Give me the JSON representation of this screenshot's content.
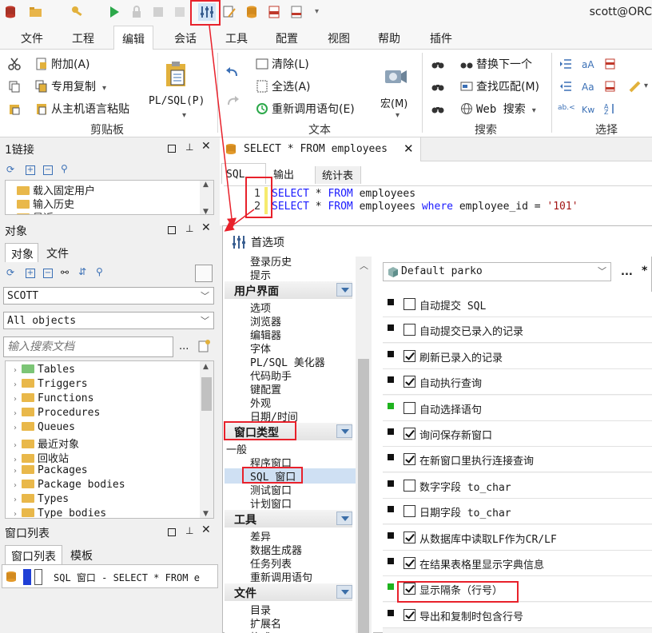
{
  "app": {
    "connection_title": "scott@ORC"
  },
  "ribbon_tabs": [
    "文件",
    "工程",
    "编辑",
    "会话",
    "工具",
    "配置",
    "视图",
    "帮助",
    "插件"
  ],
  "ribbon": {
    "clipboard": {
      "append": "附加(A)",
      "special_copy": "专用复制",
      "paste_from_host": "从主机语言粘贴",
      "plsql_label": "PL/SQL(P)",
      "group": "剪贴板"
    },
    "text": {
      "clear": "清除(L)",
      "select_all": "全选(A)",
      "recall": "重新调用语句(E)",
      "macro": "宏(M)",
      "group": "文本"
    },
    "search": {
      "replace_next": "替换下一个",
      "find_match": "查找匹配(M)",
      "web_search": "Web 搜索",
      "group": "搜索"
    },
    "selection": {
      "group": "选择"
    }
  },
  "connections_panel": {
    "title": "1链接",
    "items": [
      "载入固定用户",
      "输入历史",
      "最近"
    ]
  },
  "objects_panel": {
    "title": "对象",
    "tabs": [
      "对象",
      "文件"
    ],
    "schema": "SCOTT",
    "filter": "All objects",
    "search_placeholder": "输入搜索文档",
    "tree": [
      "Tables",
      "Triggers",
      "Functions",
      "Procedures",
      "Queues",
      "最近对象",
      "回收站",
      "Packages",
      "Package bodies",
      "Types",
      "Type bodies"
    ]
  },
  "window_list_panel": {
    "title": "窗口列表",
    "tabs": [
      "窗口列表",
      "模板"
    ],
    "item": "SQL 窗口 - SELECT * FROM e"
  },
  "editor": {
    "tab_title": "SELECT * FROM employees",
    "subtabs": [
      "SQL",
      "输出",
      "统计表"
    ],
    "lines": [
      {
        "num": "1",
        "parts": [
          [
            "kw",
            "SELECT"
          ],
          [
            "t",
            " * "
          ],
          [
            "kw",
            "FROM"
          ],
          [
            "t",
            " employees"
          ]
        ]
      },
      {
        "num": "2",
        "parts": [
          [
            "kw",
            "SELECT"
          ],
          [
            "t",
            " * "
          ],
          [
            "kw",
            "FROM"
          ],
          [
            "t",
            " employees "
          ],
          [
            "kw",
            "where"
          ],
          [
            "t",
            " employee_id = "
          ],
          [
            "str",
            "'101'"
          ]
        ]
      }
    ]
  },
  "preferences": {
    "title": "首选项",
    "profile": "Default parko",
    "nav": {
      "top_items": [
        "登录历史",
        "提示"
      ],
      "sections": [
        {
          "label": "用户界面",
          "items": [
            "选项",
            "浏览器",
            "编辑器",
            "字体",
            "PL/SQL 美化器",
            "代码助手",
            "键配置",
            "外观",
            "日期/时间"
          ]
        },
        {
          "label": "窗口类型",
          "items": [
            "一般",
            "程序窗口",
            "SQL 窗口",
            "测试窗口",
            "计划窗口"
          ]
        },
        {
          "label": "工具",
          "items": [
            "差异",
            "数据生成器",
            "任务列表",
            "重新调用语句"
          ]
        },
        {
          "label": "文件",
          "items": [
            "目录",
            "扩展名",
            "格式"
          ]
        }
      ]
    },
    "options": [
      {
        "label": "自动提交 SQL",
        "checked": false,
        "mark": "black"
      },
      {
        "label": "自动提交已录入的记录",
        "checked": false,
        "mark": "black"
      },
      {
        "label": "刷新已录入的记录",
        "checked": true,
        "mark": "black"
      },
      {
        "label": "自动执行查询",
        "checked": true,
        "mark": "black"
      },
      {
        "label": "自动选择语句",
        "checked": false,
        "mark": "green"
      },
      {
        "label": "询问保存新窗口",
        "checked": true,
        "mark": "black"
      },
      {
        "label": "在新窗口里执行连接查询",
        "checked": true,
        "mark": "black"
      },
      {
        "label": "数字字段 to_char",
        "checked": false,
        "mark": "black"
      },
      {
        "label": "日期字段 to_char",
        "checked": false,
        "mark": "black"
      },
      {
        "label": "从数据库中读取LF作为CR/LF",
        "checked": true,
        "mark": "black"
      },
      {
        "label": "在结果表格里显示字典信息",
        "checked": true,
        "mark": "black"
      },
      {
        "label": "显示隔条（行号）",
        "checked": true,
        "mark": "green"
      },
      {
        "label": "导出和复制时包含行号",
        "checked": true,
        "mark": "black"
      }
    ]
  },
  "colors": {
    "highlight_red": "#e8212b",
    "selection_blue": "#cfe0f3",
    "keyword_blue": "#1a1aff"
  }
}
